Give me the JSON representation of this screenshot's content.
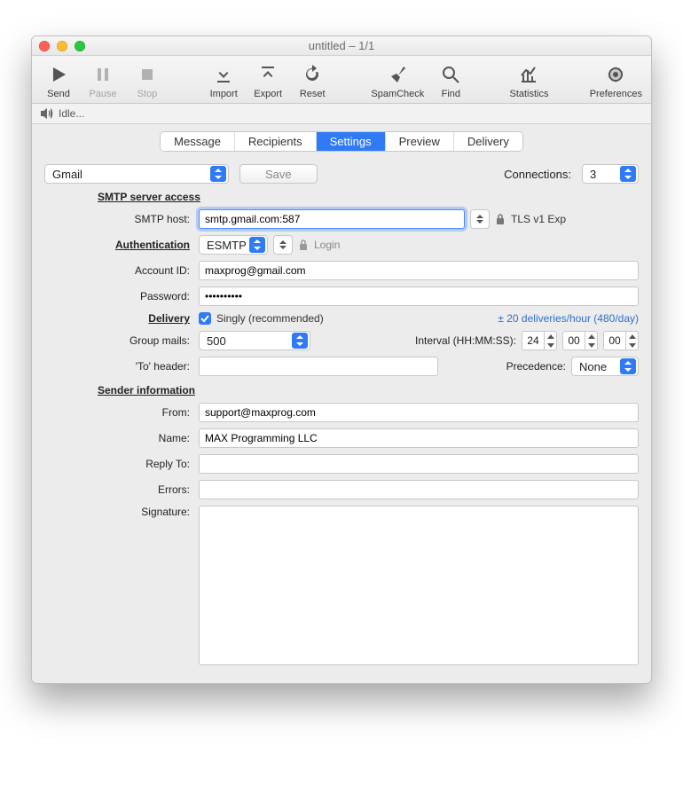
{
  "window": {
    "title": "untitled – 1/1"
  },
  "toolbar": {
    "send": "Send",
    "pause": "Pause",
    "stop": "Stop",
    "import": "Import",
    "export": "Export",
    "reset": "Reset",
    "spamcheck": "SpamCheck",
    "find": "Find",
    "statistics": "Statistics",
    "preferences": "Preferences"
  },
  "status": "Idle...",
  "tabs": {
    "message": "Message",
    "recipients": "Recipients",
    "settings": "Settings",
    "preview": "Preview",
    "delivery": "Delivery"
  },
  "top": {
    "preset": "Gmail",
    "save": "Save",
    "connections_label": "Connections:",
    "connections_value": "3"
  },
  "sections": {
    "smtp": "SMTP server access",
    "auth": "Authentication",
    "delivery": "Delivery",
    "sender": "Sender information"
  },
  "labels": {
    "smtp_host": "SMTP host:",
    "account_id": "Account ID:",
    "password": "Password:",
    "group_mails": "Group mails:",
    "to_header": "'To' header:",
    "from": "From:",
    "name": "Name:",
    "reply_to": "Reply To:",
    "errors": "Errors:",
    "signature": "Signature:",
    "interval": "Interval (HH:MM:SS):",
    "precedence": "Precedence:"
  },
  "values": {
    "smtp_host": "smtp.gmail.com:587",
    "tls": "TLS v1 Exp",
    "auth_mode": "ESMTP",
    "login": "Login",
    "account_id": "maxprog@gmail.com",
    "password": "••••••••••",
    "singly": "Singly (recommended)",
    "rate_hint": "± 20 deliveries/hour (480/day)",
    "group_mails": "500",
    "hh": "24",
    "mm": "00",
    "ss": "00",
    "to_header": "",
    "precedence": "None",
    "from": "support@maxprog.com",
    "name": "MAX Programming LLC",
    "reply_to": "",
    "errors": "",
    "signature": ""
  }
}
